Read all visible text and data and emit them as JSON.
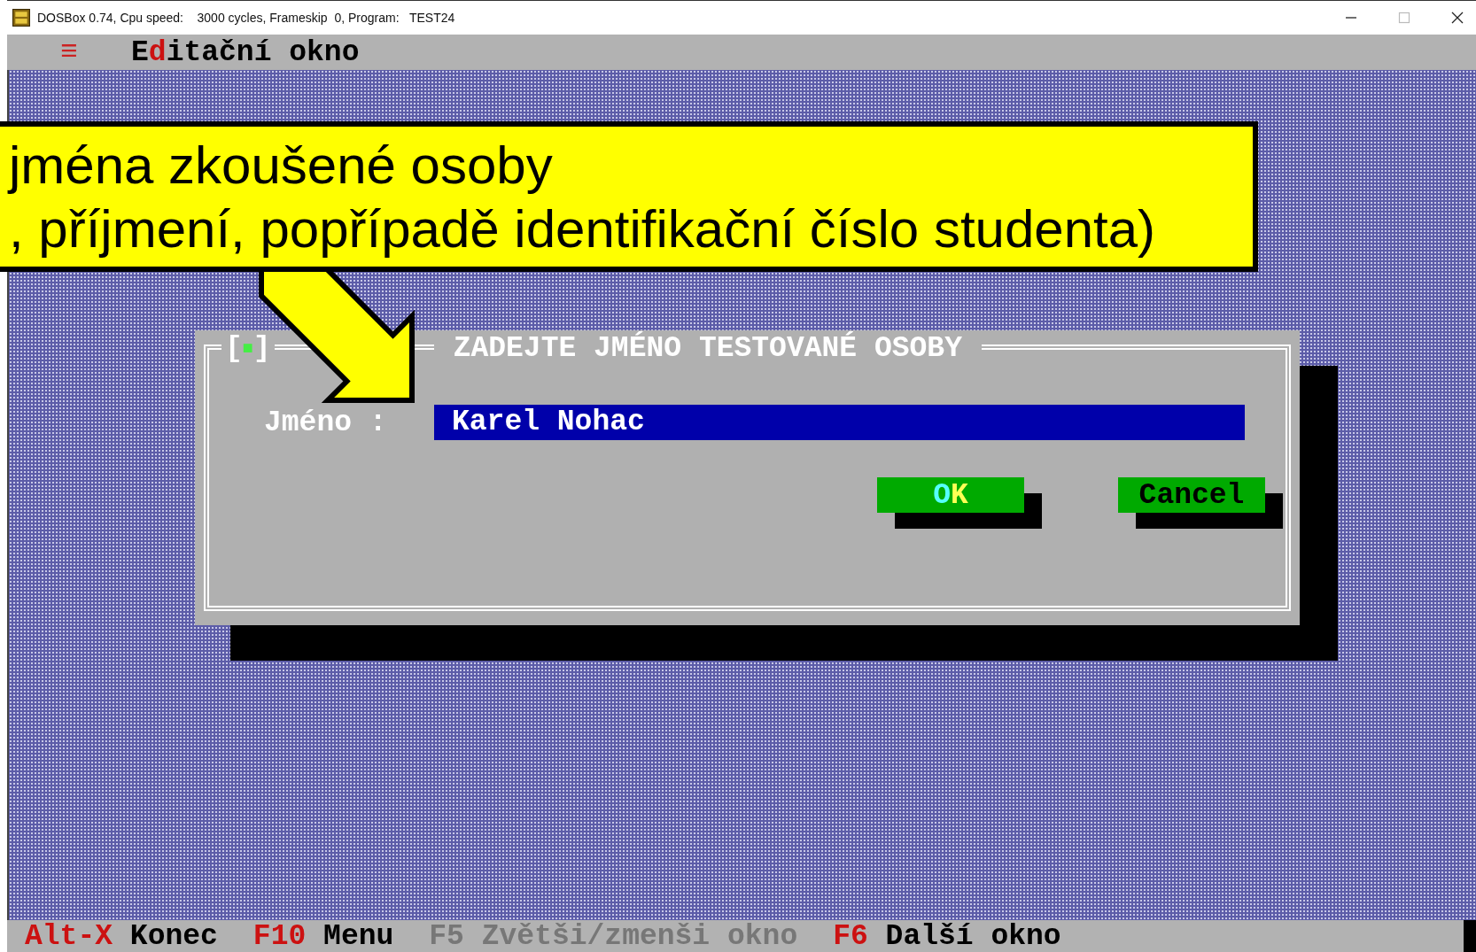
{
  "window": {
    "title": "DOSBox 0.74, Cpu speed:    3000 cycles, Frameskip  0, Program:   TEST24"
  },
  "menu_bar": {
    "menu_glyph": "≡",
    "title": {
      "before": "E",
      "hotkey": "d",
      "after": "itační okno"
    }
  },
  "callout": {
    "lines": [
      "jména zkoušené osoby",
      ", příjmení, popřípadě identifikační číslo studenta)"
    ]
  },
  "dialog": {
    "close_button": {
      "left": "[",
      "glyph": "■",
      "right": "]"
    },
    "title": "ZADEJTE JMÉNO TESTOVANÉ OSOBY",
    "field": {
      "label": "Jméno :",
      "value": "Karel Nohac"
    },
    "buttons": [
      {
        "label": "OK",
        "kind": "default"
      },
      {
        "label": "Cancel",
        "kind": "normal"
      }
    ]
  },
  "status_bar": [
    {
      "key": "Alt-X",
      "label": "Konec",
      "disabled": false
    },
    {
      "key": "F10",
      "label": "Menu",
      "disabled": false
    },
    {
      "key": "F5",
      "label": "Zvětši/zmenši okno",
      "disabled": true
    },
    {
      "key": "F6",
      "label": "Další okno",
      "disabled": false
    }
  ]
}
